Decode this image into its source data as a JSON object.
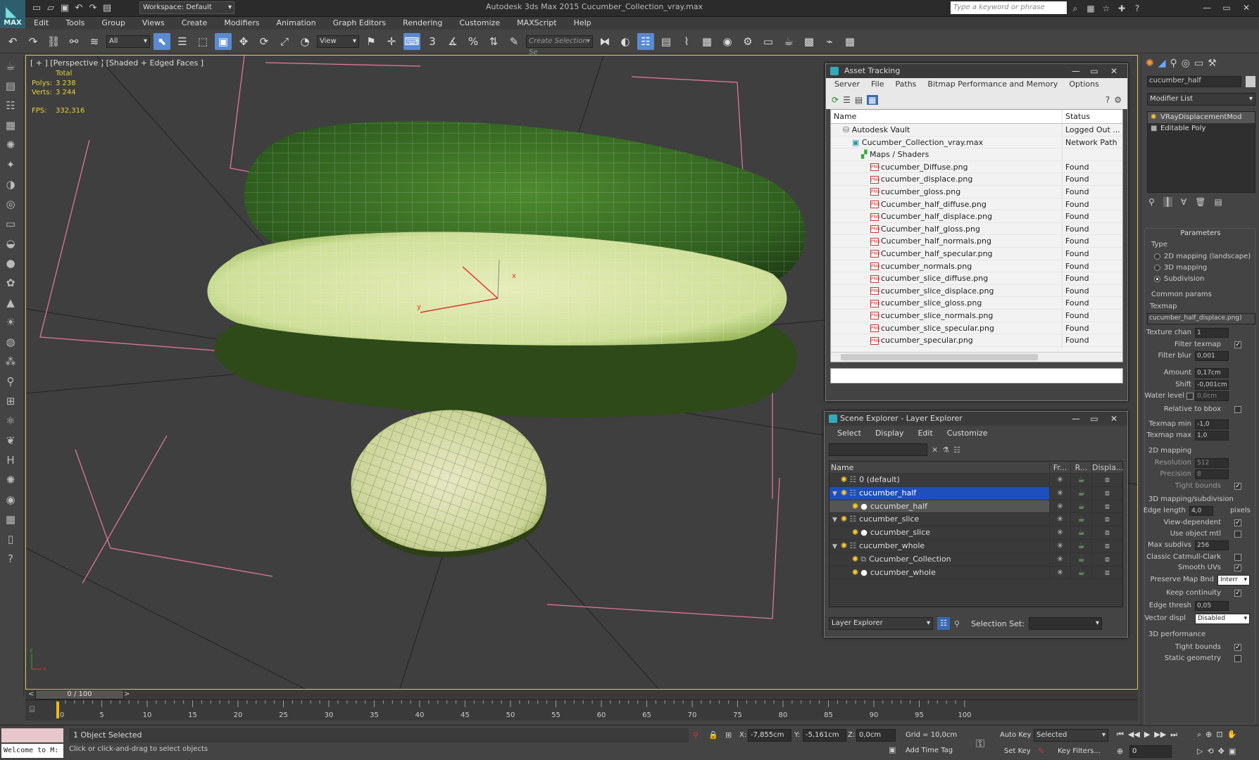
{
  "titlebar": {
    "logo_label": "MAX",
    "workspace": "Workspace: Default",
    "app_title": "Autodesk 3ds Max  2015     Cucumber_Collection_vray.max",
    "search_placeholder": "Type a keyword or phrase"
  },
  "menu": [
    "Edit",
    "Tools",
    "Group",
    "Views",
    "Create",
    "Modifiers",
    "Animation",
    "Graph Editors",
    "Rendering",
    "Customize",
    "MAXScript",
    "Help"
  ],
  "toolbar": {
    "filter_value": "All",
    "refcoord_value": "View",
    "selection_set_placeholder": "Create Selection Se",
    "snap_labels": [
      "3",
      "%"
    ]
  },
  "viewport": {
    "label": "[ + ] [Perspective ] [Shaded + Edged Faces ]",
    "stats_header": "Total",
    "polys_label": "Polys:",
    "polys_value": "3 238",
    "verts_label": "Verts:",
    "verts_value": "3 244",
    "fps_label": "FPS:",
    "fps_value": "332,316",
    "gizmo_x": "x",
    "gizmo_y": "y",
    "axis_x": "x",
    "axis_z": "z"
  },
  "asset_tracking": {
    "title": "Asset Tracking",
    "menu": [
      "Server",
      "File",
      "Paths",
      "Bitmap Performance and Memory",
      "Options"
    ],
    "col_name": "Name",
    "col_status": "Status",
    "rows": [
      {
        "name": "Autodesk Vault",
        "status": "Logged Out ...",
        "indent": 1,
        "kind": "vault"
      },
      {
        "name": "Cucumber_Collection_vray.max",
        "status": "Network Path",
        "indent": 2,
        "kind": "max"
      },
      {
        "name": "Maps / Shaders",
        "status": "",
        "indent": 3,
        "kind": "maps"
      },
      {
        "name": "cucumber_Diffuse.png",
        "status": "Found",
        "indent": 4,
        "kind": "png"
      },
      {
        "name": "cucumber_displace.png",
        "status": "Found",
        "indent": 4,
        "kind": "png"
      },
      {
        "name": "cucumber_gloss.png",
        "status": "Found",
        "indent": 4,
        "kind": "png"
      },
      {
        "name": "Cucumber_half_diffuse.png",
        "status": "Found",
        "indent": 4,
        "kind": "png"
      },
      {
        "name": "Cucumber_half_displace.png",
        "status": "Found",
        "indent": 4,
        "kind": "png"
      },
      {
        "name": "Cucumber_half_gloss.png",
        "status": "Found",
        "indent": 4,
        "kind": "png"
      },
      {
        "name": "Cucumber_half_normals.png",
        "status": "Found",
        "indent": 4,
        "kind": "png"
      },
      {
        "name": "Cucumber_half_specular.png",
        "status": "Found",
        "indent": 4,
        "kind": "png"
      },
      {
        "name": "cucumber_normals.png",
        "status": "Found",
        "indent": 4,
        "kind": "png"
      },
      {
        "name": "cucumber_slice_diffuse.png",
        "status": "Found",
        "indent": 4,
        "kind": "png"
      },
      {
        "name": "cucumber_slice_displace.png",
        "status": "Found",
        "indent": 4,
        "kind": "png"
      },
      {
        "name": "cucumber_slice_gloss.png",
        "status": "Found",
        "indent": 4,
        "kind": "png"
      },
      {
        "name": "cucumber_slice_normals.png",
        "status": "Found",
        "indent": 4,
        "kind": "png"
      },
      {
        "name": "cucumber_slice_specular.png",
        "status": "Found",
        "indent": 4,
        "kind": "png"
      },
      {
        "name": "cucumber_specular.png",
        "status": "Found",
        "indent": 4,
        "kind": "png"
      }
    ]
  },
  "scene_explorer": {
    "title": "Scene Explorer - Layer Explorer",
    "menu": [
      "Select",
      "Display",
      "Edit",
      "Customize"
    ],
    "col_name": "Name",
    "col_fr": "Fr...",
    "col_r": "R...",
    "col_disp": "Displa...",
    "rows": [
      {
        "name": "0 (default)",
        "indent": 0,
        "kind": "layer",
        "state": ""
      },
      {
        "name": "cucumber_half",
        "indent": 0,
        "kind": "layer",
        "state": "sel",
        "expand": "▼"
      },
      {
        "name": "cucumber_half",
        "indent": 1,
        "kind": "obj",
        "state": "sub"
      },
      {
        "name": "cucumber_slice",
        "indent": 0,
        "kind": "layer",
        "state": "",
        "expand": "▼"
      },
      {
        "name": "cucumber_slice",
        "indent": 1,
        "kind": "obj",
        "state": ""
      },
      {
        "name": "cucumber_whole",
        "indent": 0,
        "kind": "layer",
        "state": "",
        "expand": "▼"
      },
      {
        "name": "Cucumber_Collection",
        "indent": 1,
        "kind": "group",
        "state": ""
      },
      {
        "name": "cucumber_whole",
        "indent": 1,
        "kind": "obj",
        "state": ""
      }
    ],
    "footer_mode": "Layer Explorer",
    "selection_set_label": "Selection Set:"
  },
  "command_panel": {
    "object_name": "cucumber_half",
    "modifier_list": "Modifier List",
    "stack": [
      "VRayDisplacementMod",
      "Editable Poly"
    ],
    "parameters_title": "Parameters",
    "type_label": "Type",
    "type_options": [
      "2D mapping (landscape)",
      "3D mapping",
      "Subdivision"
    ],
    "type_selected": 2,
    "common_params": "Common params",
    "texmap_label": "Texmap",
    "texmap_value": "cucumber_half_displace.png)",
    "texture_chan_label": "Texture chan",
    "texture_chan_value": "1",
    "filter_texmap_label": "Filter texmap",
    "filter_blur_label": "Filter blur",
    "filter_blur_value": "0,001",
    "amount_label": "Amount",
    "amount_value": "0,17cm",
    "shift_label": "Shift",
    "shift_value": "-0,001cm",
    "water_level_label": "Water level",
    "water_level_value": "0,0cm",
    "relative_bbox_label": "Relative to bbox",
    "texmap_min_label": "Texmap min",
    "texmap_min_value": "-1,0",
    "texmap_max_label": "Texmap max",
    "texmap_max_value": "1,0",
    "mapping2d_title": "2D mapping",
    "resolution_label": "Resolution",
    "resolution_value": "512",
    "precision_label": "Precision",
    "precision_value": "8",
    "tight_bounds_label": "Tight bounds",
    "mapping3d_title": "3D mapping/subdivision",
    "edge_length_label": "Edge length",
    "edge_length_value": "4,0",
    "pixels_label": "pixels",
    "view_dependent_label": "View-dependent",
    "use_object_mtl_label": "Use object mtl",
    "max_subdivs_label": "Max subdivs",
    "max_subdivs_value": "256",
    "catmull_label": "Classic Catmull-Clark",
    "smooth_uvs_label": "Smooth UVs",
    "preserve_map_label": "Preserve Map Bnd",
    "preserve_map_value": "Interr",
    "keep_continuity_label": "Keep continuity",
    "edge_thresh_label": "Edge thresh",
    "edge_thresh_value": "0,05",
    "vector_displ_label": "Vector displ",
    "vector_displ_value": "Disabled",
    "perf_title": "3D performance",
    "tight_bounds2_label": "Tight bounds",
    "static_geometry_label": "Static geometry"
  },
  "timeline": {
    "frame_counter": "0 / 100",
    "ticks": [
      "0",
      "5",
      "10",
      "15",
      "20",
      "25",
      "30",
      "35",
      "40",
      "45",
      "50",
      "55",
      "60",
      "65",
      "70",
      "75",
      "80",
      "85",
      "90",
      "95",
      "100"
    ]
  },
  "status": {
    "maxscript": "Welcome to M:",
    "selected": "1 Object Selected",
    "prompt": "Click or click-and-drag to select objects",
    "x_label": "X:",
    "x_value": "-7,855cm",
    "y_label": "Y:",
    "y_value": "-5,161cm",
    "z_label": "Z:",
    "z_value": "0,0cm",
    "grid": "Grid = 10,0cm",
    "add_time_tag": "Add Time Tag",
    "auto_key": "Auto Key",
    "set_key": "Set Key",
    "selected_dd": "Selected",
    "key_filters": "Key Filters...",
    "frame_value": "0"
  },
  "colors": {
    "accent_blue": "#1f4fbd",
    "viewport_border": "#d8c36b",
    "stats_yellow": "#e6d23c",
    "cucumber_dark": "#2f5e1f",
    "cucumber_light": "#e6ecb9"
  }
}
